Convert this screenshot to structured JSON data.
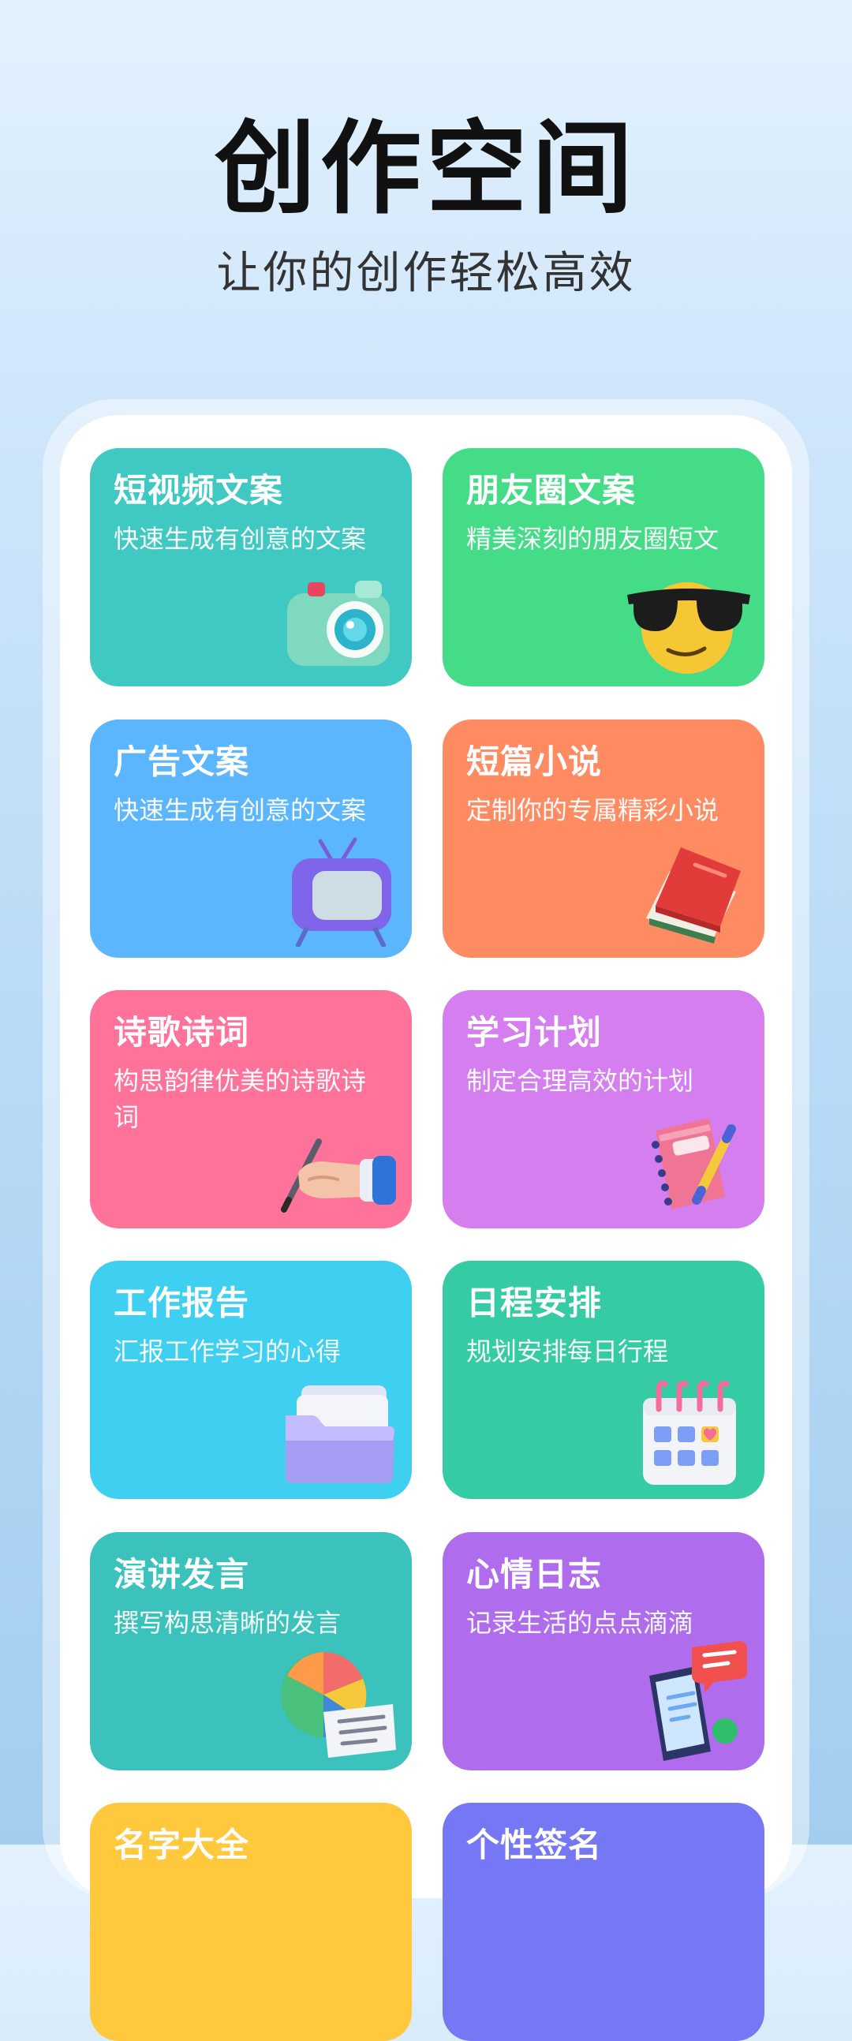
{
  "header": {
    "title": "创作空间",
    "subtitle": "让你的创作轻松高效"
  },
  "cards": [
    {
      "title": "短视频文案",
      "desc": "快速生成有创意的文案",
      "color": "#40c9c2",
      "icon": "camera-icon"
    },
    {
      "title": "朋友圈文案",
      "desc": "精美深刻的朋友圈短文",
      "color": "#45dc88",
      "icon": "sunglasses-emoji-icon"
    },
    {
      "title": "广告文案",
      "desc": "快速生成有创意的文案",
      "color": "#5cb6fd",
      "icon": "tv-icon"
    },
    {
      "title": "短篇小说",
      "desc": "定制你的专属精彩小说",
      "color": "#ff8b63",
      "icon": "book-icon"
    },
    {
      "title": "诗歌诗词",
      "desc": "构思韵律优美的诗歌诗词",
      "color": "#ff7299",
      "icon": "writing-hand-icon"
    },
    {
      "title": "学习计划",
      "desc": "制定合理高效的计划",
      "color": "#d57ef0",
      "icon": "notebook-pen-icon"
    },
    {
      "title": "工作报告",
      "desc": "汇报工作学习的心得",
      "color": "#3ecff1",
      "icon": "folder-icon"
    },
    {
      "title": "日程安排",
      "desc": "规划安排每日行程",
      "color": "#35cba5",
      "icon": "calendar-icon"
    },
    {
      "title": "演讲发言",
      "desc": "撰写构思清晰的发言",
      "color": "#3bc2bc",
      "icon": "pie-chart-document-icon"
    },
    {
      "title": "心情日志",
      "desc": "记录生活的点点滴滴",
      "color": "#af6ded",
      "icon": "phone-chat-icon"
    },
    {
      "title": "名字大全",
      "desc": "",
      "color": "#ffc83d",
      "icon": ""
    },
    {
      "title": "个性签名",
      "desc": "",
      "color": "#7677f4",
      "icon": ""
    }
  ]
}
